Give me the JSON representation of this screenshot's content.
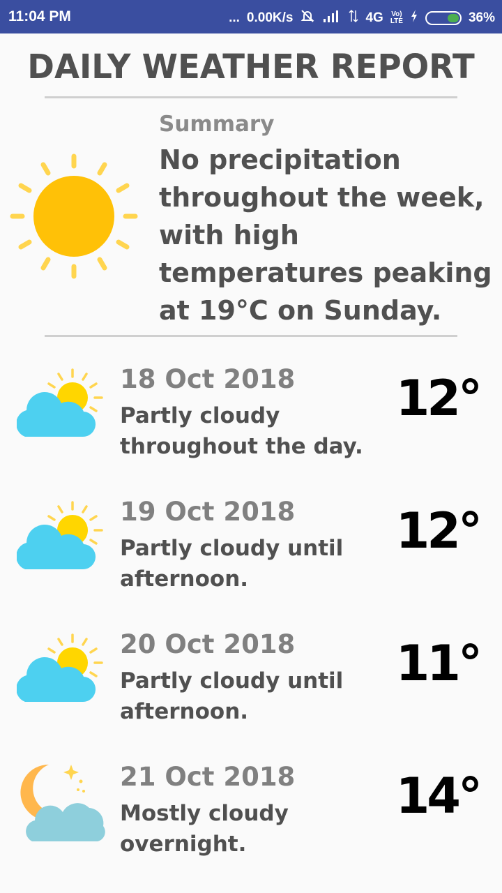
{
  "status_bar": {
    "time": "11:04 PM",
    "dots": "...",
    "net_speed": "0.00K/s",
    "network": "4G",
    "volte_top": "Vo)",
    "volte_bottom": "LTE",
    "battery": "36%",
    "battery_level": 0.36
  },
  "header": {
    "title": "DAILY WEATHER REPORT"
  },
  "summary": {
    "icon": "sun-icon",
    "label": "Summary",
    "text": "No precipitation throughout the week, with high temperatures peaking at 19°C on Sunday."
  },
  "days": [
    {
      "date": "18 Oct 2018",
      "description": "Partly cloudy throughout the day.",
      "temperature": "12°",
      "icon": "partly-cloudy-day-icon"
    },
    {
      "date": "19 Oct 2018",
      "description": "Partly cloudy until afternoon.",
      "temperature": "12°",
      "icon": "partly-cloudy-day-icon"
    },
    {
      "date": "20 Oct 2018",
      "description": "Partly cloudy until afternoon.",
      "temperature": "11°",
      "icon": "partly-cloudy-day-icon"
    },
    {
      "date": "21 Oct 2018",
      "description": "Mostly cloudy overnight.",
      "temperature": "14°",
      "icon": "partly-cloudy-night-icon"
    }
  ],
  "colors": {
    "status_bar": "#3a4ea0",
    "sun": "#ffc107",
    "sun_rays": "#ffd54f",
    "cloud": "#4dd0f0",
    "night_cloud": "#8ecfdc",
    "moon": "#ffb74d",
    "title_text": "#505050"
  }
}
